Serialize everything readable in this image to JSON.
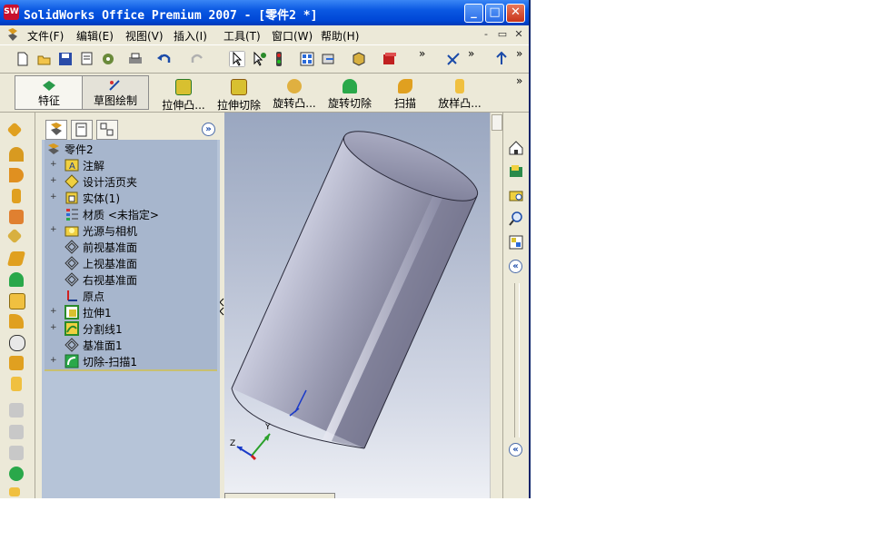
{
  "window": {
    "title": "SolidWorks Office Premium 2007 - [零件2 *]",
    "app_icon": "SW",
    "controls": [
      "_",
      "□",
      "✕"
    ]
  },
  "menubar": {
    "items": [
      "文件(F)",
      "编辑(E)",
      "视图(V)",
      "插入(I)",
      "工具(T)",
      "窗口(W)",
      "帮助(H)"
    ],
    "mdi_controls": [
      "-",
      "▭",
      "✕"
    ]
  },
  "toolbar_std": {
    "icons": [
      "new-icon",
      "open-icon",
      "save-icon",
      "print-preview-icon",
      "options-icon",
      "print-icon",
      "undo-icon",
      "redo-icon",
      "select-icon",
      "select-other-icon",
      "traffic-light-icon",
      "grid-icon",
      "view-orientation-icon",
      "display-style-icon",
      "appearance-icon",
      "sketch-relations-icon",
      "arrow-up-icon"
    ],
    "chevrons": [
      "»",
      "»",
      "»"
    ]
  },
  "command_manager": {
    "feature_label": "特征",
    "sketch_label": "草图绘制",
    "commands": [
      "拉伸凸...",
      "拉伸切除",
      "旋转凸...",
      "旋转切除",
      "扫描",
      "放样凸..."
    ],
    "chevron": "»"
  },
  "feature_manager": {
    "tabs": [
      "feature-tree-tab",
      "property-tab",
      "configuration-tab"
    ],
    "expand_button": "»",
    "root": "零件2",
    "items": [
      {
        "label": "注解",
        "icon": "annotation-icon",
        "expandable": true
      },
      {
        "label": "设计活页夹",
        "icon": "design-binder-icon",
        "expandable": true
      },
      {
        "label": "实体(1)",
        "icon": "solid-body-icon",
        "expandable": true
      },
      {
        "label": "材质 <未指定>",
        "icon": "material-icon",
        "expandable": false
      },
      {
        "label": "光源与相机",
        "icon": "lights-icon",
        "expandable": true
      },
      {
        "label": "前视基准面",
        "icon": "plane-icon",
        "expandable": false
      },
      {
        "label": "上视基准面",
        "icon": "plane-icon",
        "expandable": false
      },
      {
        "label": "右视基准面",
        "icon": "plane-icon",
        "expandable": false
      },
      {
        "label": "原点",
        "icon": "origin-icon",
        "expandable": false
      },
      {
        "label": "拉伸1",
        "icon": "extrude-icon",
        "expandable": true
      },
      {
        "label": "分割线1",
        "icon": "split-line-icon",
        "expandable": true
      },
      {
        "label": "基准面1",
        "icon": "plane-icon",
        "expandable": false
      },
      {
        "label": "切除-扫描1",
        "icon": "cut-sweep-icon",
        "expandable": true
      }
    ]
  },
  "viewport": {
    "triad": {
      "x": "",
      "y": "Y",
      "z": "Z"
    }
  },
  "taskpane": {
    "icons": [
      "home-icon",
      "library-icon",
      "explorer-icon",
      "search-icon",
      "palette-icon"
    ],
    "collapse": "«"
  },
  "colors": {
    "titlebar": "#0a58e2",
    "tree_bg": "#a7b6cd",
    "cylinder": "#8d8ea8"
  }
}
